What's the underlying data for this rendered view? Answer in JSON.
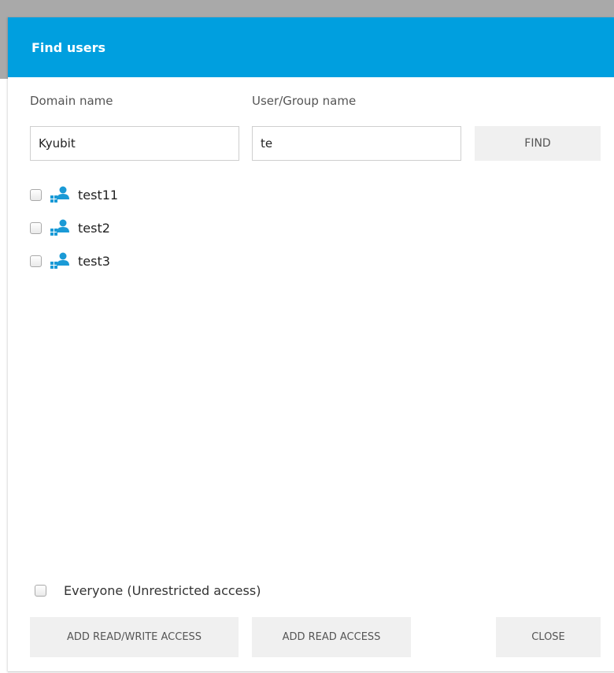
{
  "dialog": {
    "title": "Find users"
  },
  "search": {
    "domain_label": "Domain name",
    "domain_value": "Kyubit",
    "user_label": "User/Group name",
    "user_value": "te",
    "find_label": "FIND"
  },
  "results": [
    {
      "label": "test11",
      "checked": false,
      "icon": "user-group-icon"
    },
    {
      "label": "test2",
      "checked": false,
      "icon": "user-group-icon"
    },
    {
      "label": "test3",
      "checked": false,
      "icon": "user-group-icon"
    }
  ],
  "everyone": {
    "label": "Everyone (Unrestricted access)",
    "checked": false
  },
  "footer": {
    "read_write_label": "ADD READ/WRITE ACCESS",
    "read_label": "ADD READ ACCESS",
    "close_label": "CLOSE"
  },
  "colors": {
    "header": "#009fdf",
    "icon": "#1a9ad6",
    "button_bg": "#f0f0f0"
  }
}
